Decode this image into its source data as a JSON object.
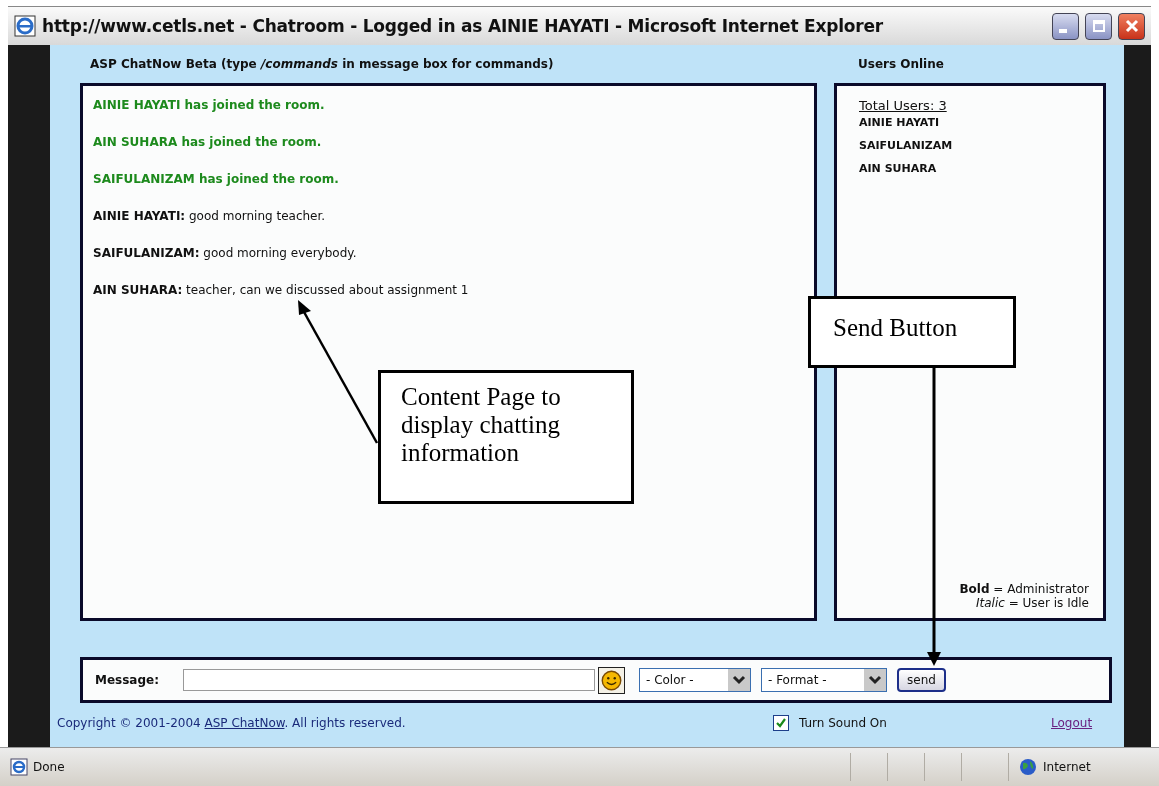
{
  "window": {
    "title": "http://www.cetls.net - Chatroom - Logged in as AINIE HAYATI - Microsoft Internet Explorer"
  },
  "chat": {
    "heading": "ASP ChatNow Beta (type */commands* in message box for commands)",
    "messages": [
      {
        "kind": "join",
        "text": "AINIE HAYATI has joined the room."
      },
      {
        "kind": "join",
        "text": "AIN SUHARA has joined the room."
      },
      {
        "kind": "join",
        "text": "SAIFULANIZAM has joined the room."
      },
      {
        "kind": "message",
        "user": "AINIE HAYATI:",
        "text": "good morning teacher."
      },
      {
        "kind": "message",
        "user": "SAIFULANIZAM:",
        "text": "good morning everybody."
      },
      {
        "kind": "message",
        "user": "AIN SUHARA:",
        "text": "teacher, can we discussed about assignment 1"
      }
    ]
  },
  "users": {
    "heading": "Users Online",
    "total": "Total Users: 3",
    "names": [
      "AINIE HAYATI",
      "SAIFULANIZAM",
      "AIN SUHARA"
    ],
    "legend": [
      "**Bold** = Administrator",
      "*Italic* = User is Idle"
    ]
  },
  "message_bar": {
    "label": "Message:",
    "color_select": "- Color -",
    "format_select": "- Format -",
    "send": "send"
  },
  "footer": {
    "copyright_start": "Copyright © 2001-2004 ",
    "link": "ASP ChatNow",
    "copyright_end": ". All rights reserved.",
    "sound": {
      "label": "Turn Sound On",
      "checked": true
    },
    "logout": "Logout"
  },
  "status_bar": {
    "text": "Done",
    "zone": "Internet"
  },
  "annotations": [
    {
      "text": "Content Page to display chatting information"
    },
    {
      "text": "Send Button"
    }
  ]
}
